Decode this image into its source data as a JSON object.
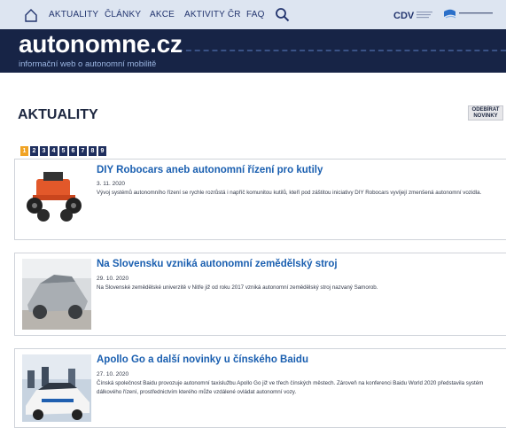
{
  "nav": {
    "items": [
      "AKTUALITY",
      "ČLÁNKY",
      "AKCE",
      "AKTIVITY ČR",
      "FAQ"
    ],
    "home_icon": "home-icon",
    "search_icon": "search-icon"
  },
  "partners": [
    "CDV",
    "Ministerstvo dopravy"
  ],
  "brand": {
    "name": "autonomne.cz",
    "tagline": "informační web o autonomní mobilitě"
  },
  "page": {
    "title": "AKTUALITY",
    "subscribe_label": "ODEBÍRAT NOVINKY"
  },
  "pagination": {
    "pages": [
      "1",
      "2",
      "3",
      "4",
      "5",
      "6",
      "7",
      "8",
      "9"
    ],
    "current": "1"
  },
  "articles": [
    {
      "title": "DIY Robocars aneb autonomní řízení pro kutily",
      "date": "3. 11. 2020",
      "excerpt": "Vývoj systémů autonomního řízení se rychle rozrůstá i napříč komunitou kutilů, kteří pod záštitou iniciativy DIY Robocars vyvíjejí zmenšená autonomní vozidla."
    },
    {
      "title": "Na Slovensku vzniká autonomní zemědělský stroj",
      "date": "29. 10. 2020",
      "excerpt": "Na Slovenské zemědělské univerzitě v Nitře již od roku 2017 vzniká autonomní zemědělský stroj nazvaný Samorob."
    },
    {
      "title": "Apollo Go a další novinky u čínského Baidu",
      "date": "27. 10. 2020",
      "excerpt": "Čínská společnost Baidu provozuje autonomní taxislužbu Apollo Go již ve třech čínských městech. Zároveň na konferenci Baidu World 2020 představila systém dálkového řízení, prostřednictvím kterého může vzdálené ovládat autonomní vozy."
    }
  ],
  "colors": {
    "topbar_bg": "#dde5f1",
    "banner_bg": "#172446",
    "accent_orange": "#f0a324",
    "link_blue": "#1a5fb0"
  }
}
